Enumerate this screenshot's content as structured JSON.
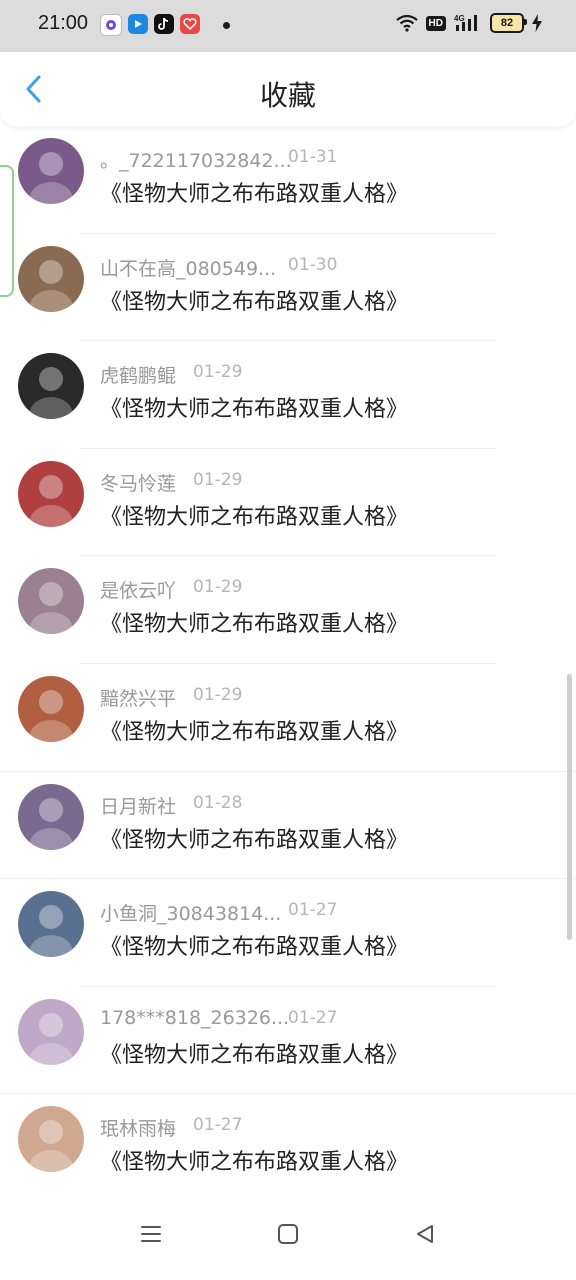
{
  "status_bar": {
    "time": "21:00",
    "hd": "HD",
    "network": "4G",
    "battery": "82"
  },
  "header": {
    "title": "收藏"
  },
  "items": [
    {
      "name": "。_722117032842...",
      "date": "01-31",
      "title": "《怪物大师之布布路双重人格》",
      "avatar_color": "#7a5a8a"
    },
    {
      "name": "山不在高_080549...",
      "date": "01-30",
      "title": "《怪物大师之布布路双重人格》",
      "avatar_color": "#8a6a50"
    },
    {
      "name": "虎鹤鹏鲲",
      "date": "01-29",
      "title": "《怪物大师之布布路双重人格》",
      "avatar_color": "#2a2a2a"
    },
    {
      "name": "冬马怜莲",
      "date": "01-29",
      "title": "《怪物大师之布布路双重人格》",
      "avatar_color": "#b04040"
    },
    {
      "name": "是依云吖",
      "date": "01-29",
      "title": "《怪物大师之布布路双重人格》",
      "avatar_color": "#9a8090"
    },
    {
      "name": "黯然兴平",
      "date": "01-29",
      "title": "《怪物大师之布布路双重人格》",
      "avatar_color": "#b06040"
    },
    {
      "name": "日月新社",
      "date": "01-28",
      "title": "《怪物大师之布布路双重人格》",
      "avatar_color": "#7a6a90"
    },
    {
      "name": "小鱼洞_30843814...",
      "date": "01-27",
      "title": "《怪物大师之布布路双重人格》",
      "avatar_color": "#5a7090"
    },
    {
      "name": "178***818_26326...",
      "date": "01-27",
      "title": "《怪物大师之布布路双重人格》",
      "avatar_color": "#c0a8c8"
    },
    {
      "name": "珉林雨梅",
      "date": "01-27",
      "title": "《怪物大师之布布路双重人格》",
      "avatar_color": "#d0a890"
    }
  ],
  "colors": {
    "accent": "#3aa0e8",
    "text_primary": "#222222",
    "text_secondary": "#999999"
  }
}
